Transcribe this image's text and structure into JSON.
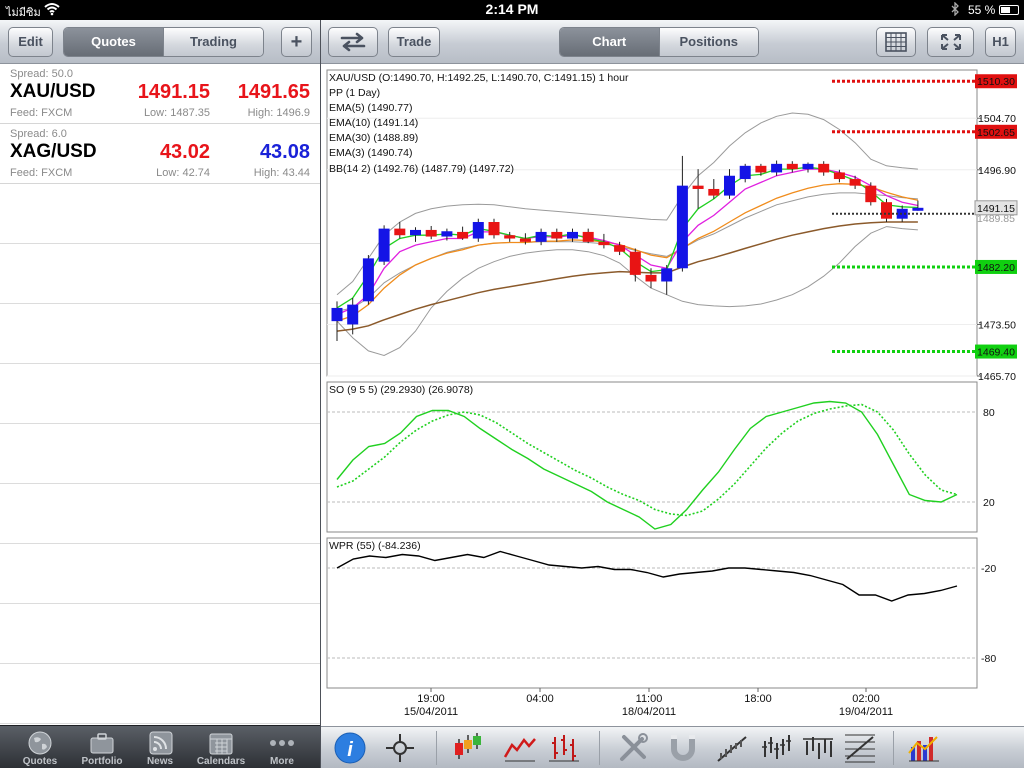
{
  "status_bar": {
    "carrier": "ไม่มีซิม",
    "time": "2:14 PM",
    "battery_text": "55 %",
    "battery_level": 0.55
  },
  "left_toolbar": {
    "edit": "Edit",
    "quotes": "Quotes",
    "trading": "Trading",
    "add": "+"
  },
  "quotes": [
    {
      "spread": "Spread: 50.0",
      "symbol": "XAU/USD",
      "feed": "Feed: FXCM",
      "bid": "1491.15",
      "ask": "1491.65",
      "low": "Low: 1487.35",
      "high": "High: 1496.9",
      "ask_color": "#e8141a"
    },
    {
      "spread": "Spread: 6.0",
      "symbol": "XAG/USD",
      "feed": "Feed: FXCM",
      "bid": "43.02",
      "ask": "43.08",
      "low": "Low: 42.74",
      "high": "High: 43.44",
      "ask_color": "#1a22d8"
    }
  ],
  "tabbar": {
    "items": [
      "Quotes",
      "Portfolio",
      "News",
      "Calendars",
      "More"
    ]
  },
  "right_toolbar": {
    "trade": "Trade",
    "chart": "Chart",
    "positions": "Positions",
    "timeframe": "H1"
  },
  "legend": {
    "main": "XAU/USD (O:1490.70, H:1492.25, L:1490.70, C:1491.15) 1 hour",
    "pp": "PP (1 Day)",
    "ema5": "EMA(5) (1490.77)",
    "ema10": "EMA(10) (1491.14)",
    "ema30": "EMA(30) (1488.89)",
    "ema3": "EMA(3) (1490.74)",
    "bb": "BB(14 2) (1492.76) (1487.79) (1497.72)",
    "so": "SO (9 5 5) (29.2930) (26.9078)",
    "wpr": "WPR (55) (-84.236)"
  },
  "price_axis": {
    "ticks": [
      "1504.70",
      "1496.90",
      "1473.50",
      "1465.70"
    ],
    "current": "1491.15",
    "current_hidden": "1489.85"
  },
  "pivot_levels": [
    {
      "label": "1510.30",
      "value": 1510.3,
      "kind": "resistance"
    },
    {
      "label": "1502.65",
      "value": 1502.65,
      "kind": "resistance"
    },
    {
      "label": "1482.20",
      "value": 1482.2,
      "kind": "support"
    },
    {
      "label": "1469.40",
      "value": 1469.4,
      "kind": "support"
    }
  ],
  "so_axis": {
    "ticks": [
      "80",
      "20"
    ]
  },
  "wpr_axis": {
    "ticks": [
      "-20",
      "-80"
    ]
  },
  "time_axis": [
    {
      "time": "19:00",
      "date": "15/04/2011"
    },
    {
      "time": "04:00",
      "date": ""
    },
    {
      "time": "11:00",
      "date": "18/04/2011"
    },
    {
      "time": "18:00",
      "date": ""
    },
    {
      "time": "02:00",
      "date": "19/04/2011"
    }
  ],
  "colors": {
    "up": "#1414e6",
    "down": "#e81414",
    "resistance": "#e01010",
    "support": "#10d010",
    "ema5": "#e020e0",
    "ema10": "#f08c1c",
    "ema30": "#8b5a2b",
    "ema3": "#20d020",
    "bb": "#9a9a9a"
  },
  "chart_data": {
    "type": "candlestick",
    "symbol": "XAU/USD",
    "interval": "1 hour",
    "ylim": [
      1465.7,
      1512
    ],
    "candles": [
      {
        "o": 1474.0,
        "h": 1477.0,
        "l": 1471.0,
        "c": 1476.0
      },
      {
        "o": 1473.5,
        "h": 1477.5,
        "l": 1472.0,
        "c": 1476.5
      },
      {
        "o": 1477.0,
        "h": 1484.0,
        "l": 1476.5,
        "c": 1483.5
      },
      {
        "o": 1483.0,
        "h": 1488.5,
        "l": 1482.5,
        "c": 1488.0
      },
      {
        "o": 1488.0,
        "h": 1489.0,
        "l": 1486.5,
        "c": 1487.0
      },
      {
        "o": 1487.0,
        "h": 1488.2,
        "l": 1486.0,
        "c": 1487.8
      },
      {
        "o": 1487.8,
        "h": 1488.4,
        "l": 1486.4,
        "c": 1486.8
      },
      {
        "o": 1486.8,
        "h": 1488.0,
        "l": 1486.2,
        "c": 1487.6
      },
      {
        "o": 1487.5,
        "h": 1488.3,
        "l": 1486.3,
        "c": 1486.5
      },
      {
        "o": 1486.5,
        "h": 1489.5,
        "l": 1486.0,
        "c": 1489.0
      },
      {
        "o": 1489.0,
        "h": 1489.5,
        "l": 1486.5,
        "c": 1487.0
      },
      {
        "o": 1487.0,
        "h": 1487.5,
        "l": 1486.0,
        "c": 1486.5
      },
      {
        "o": 1486.5,
        "h": 1487.3,
        "l": 1485.6,
        "c": 1486.0
      },
      {
        "o": 1486.0,
        "h": 1488.0,
        "l": 1485.5,
        "c": 1487.5
      },
      {
        "o": 1487.5,
        "h": 1488.0,
        "l": 1486.0,
        "c": 1486.5
      },
      {
        "o": 1486.5,
        "h": 1488.0,
        "l": 1486.0,
        "c": 1487.5
      },
      {
        "o": 1487.5,
        "h": 1488.0,
        "l": 1485.8,
        "c": 1486.0
      },
      {
        "o": 1486.0,
        "h": 1487.2,
        "l": 1485.0,
        "c": 1485.5
      },
      {
        "o": 1485.5,
        "h": 1486.0,
        "l": 1484.0,
        "c": 1484.5
      },
      {
        "o": 1484.5,
        "h": 1485.0,
        "l": 1480.0,
        "c": 1481.0
      },
      {
        "o": 1481.0,
        "h": 1482.0,
        "l": 1479.0,
        "c": 1480.0
      },
      {
        "o": 1480.0,
        "h": 1482.5,
        "l": 1478.0,
        "c": 1482.0
      },
      {
        "o": 1482.0,
        "h": 1499.0,
        "l": 1481.5,
        "c": 1494.5
      },
      {
        "o": 1494.5,
        "h": 1497.0,
        "l": 1491.0,
        "c": 1494.0
      },
      {
        "o": 1494.0,
        "h": 1495.5,
        "l": 1492.5,
        "c": 1493.0
      },
      {
        "o": 1493.0,
        "h": 1497.0,
        "l": 1492.5,
        "c": 1496.0
      },
      {
        "o": 1495.5,
        "h": 1497.8,
        "l": 1495.0,
        "c": 1497.5
      },
      {
        "o": 1497.5,
        "h": 1497.8,
        "l": 1496.0,
        "c": 1496.5
      },
      {
        "o": 1496.5,
        "h": 1498.3,
        "l": 1496.0,
        "c": 1497.8
      },
      {
        "o": 1497.8,
        "h": 1498.2,
        "l": 1496.5,
        "c": 1497.0
      },
      {
        "o": 1497.0,
        "h": 1498.0,
        "l": 1496.5,
        "c": 1497.8
      },
      {
        "o": 1497.8,
        "h": 1498.2,
        "l": 1496.0,
        "c": 1496.5
      },
      {
        "o": 1496.5,
        "h": 1496.9,
        "l": 1495.0,
        "c": 1495.5
      },
      {
        "o": 1495.5,
        "h": 1496.0,
        "l": 1494.0,
        "c": 1494.5
      },
      {
        "o": 1494.5,
        "h": 1495.0,
        "l": 1491.5,
        "c": 1492.0
      },
      {
        "o": 1492.0,
        "h": 1492.5,
        "l": 1489.0,
        "c": 1489.5
      },
      {
        "o": 1489.5,
        "h": 1491.5,
        "l": 1489.0,
        "c": 1491.0
      },
      {
        "o": 1490.7,
        "h": 1492.25,
        "l": 1490.7,
        "c": 1491.15
      }
    ],
    "ema5": [
      1475.0,
      1476.0,
      1478.0,
      1482.0,
      1484.5,
      1485.5,
      1486.0,
      1486.5,
      1486.5,
      1487.5,
      1487.5,
      1487.0,
      1486.5,
      1486.8,
      1486.7,
      1487.0,
      1486.7,
      1486.2,
      1485.5,
      1484.0,
      1482.5,
      1482.0,
      1486.0,
      1488.5,
      1490.0,
      1492.0,
      1494.0,
      1495.0,
      1496.0,
      1496.5,
      1497.0,
      1497.0,
      1496.5,
      1495.8,
      1494.5,
      1493.0,
      1492.0,
      1491.5
    ],
    "ema10": [
      1474.0,
      1474.8,
      1476.5,
      1479.0,
      1481.0,
      1482.5,
      1483.5,
      1484.3,
      1484.8,
      1485.5,
      1485.8,
      1485.9,
      1485.9,
      1486.1,
      1486.1,
      1486.3,
      1486.2,
      1486.0,
      1485.6,
      1484.8,
      1484.0,
      1483.6,
      1485.0,
      1486.5,
      1487.6,
      1489.0,
      1490.4,
      1491.5,
      1492.6,
      1493.4,
      1494.1,
      1494.6,
      1494.8,
      1494.7,
      1494.3,
      1493.5,
      1492.8,
      1492.3
    ],
    "ema30": [
      1472.5,
      1472.8,
      1473.3,
      1474.2,
      1475.0,
      1475.8,
      1476.5,
      1477.1,
      1477.7,
      1478.3,
      1478.8,
      1479.2,
      1479.6,
      1480.0,
      1480.4,
      1480.8,
      1481.1,
      1481.3,
      1481.5,
      1481.4,
      1481.3,
      1481.3,
      1482.2,
      1483.0,
      1483.6,
      1484.3,
      1485.0,
      1485.7,
      1486.4,
      1487.0,
      1487.5,
      1488.0,
      1488.4,
      1488.7,
      1488.9,
      1489.0,
      1489.0,
      1489.0
    ],
    "ema3": [
      1476.0,
      1477.5,
      1481.0,
      1485.0,
      1486.5,
      1487.0,
      1487.0,
      1487.2,
      1487.0,
      1488.0,
      1487.6,
      1487.0,
      1486.5,
      1487.0,
      1486.8,
      1487.2,
      1486.5,
      1486.0,
      1485.0,
      1483.0,
      1481.5,
      1481.8,
      1488.0,
      1491.0,
      1492.5,
      1494.5,
      1496.0,
      1496.2,
      1497.0,
      1497.0,
      1497.3,
      1497.0,
      1496.2,
      1495.3,
      1493.6,
      1491.6,
      1491.3,
      1491.2
    ],
    "bb_upper": [
      1478.0,
      1480.0,
      1483.5,
      1487.0,
      1489.0,
      1490.3,
      1491.0,
      1491.4,
      1491.6,
      1491.7,
      1491.6,
      1491.3,
      1491.0,
      1490.8,
      1490.6,
      1490.4,
      1490.2,
      1490.0,
      1489.8,
      1489.6,
      1489.4,
      1489.3,
      1493.0,
      1496.0,
      1498.0,
      1500.5,
      1502.5,
      1504.0,
      1505.0,
      1505.5,
      1505.3,
      1504.5,
      1503.0,
      1501.0,
      1498.5,
      1497.5,
      1497.2,
      1497.0
    ],
    "bb_lower": [
      1474.0,
      1471.5,
      1469.5,
      1468.8,
      1470.0,
      1472.5,
      1476.0,
      1478.5,
      1480.5,
      1482.0,
      1483.0,
      1483.8,
      1484.3,
      1484.6,
      1484.8,
      1484.8,
      1484.5,
      1483.9,
      1482.8,
      1480.8,
      1479.0,
      1478.0,
      1477.0,
      1476.5,
      1476.3,
      1476.2,
      1476.3,
      1476.6,
      1477.2,
      1478.0,
      1479.2,
      1480.8,
      1482.8,
      1485.3,
      1487.3,
      1488.3,
      1488.0,
      1487.8
    ],
    "bb_mid": [
      1475.5,
      1476.0,
      1477.5,
      1479.8,
      1481.3,
      1482.5,
      1483.5,
      1484.4,
      1485.0,
      1485.5,
      1485.8,
      1485.9,
      1485.9,
      1486.0,
      1486.0,
      1486.0,
      1485.9,
      1485.7,
      1485.3,
      1484.7,
      1484.2,
      1483.8,
      1485.0,
      1486.3,
      1487.2,
      1488.4,
      1489.6,
      1490.6,
      1491.6,
      1492.2,
      1492.8,
      1493.2,
      1493.4,
      1493.4,
      1493.2,
      1493.0,
      1492.7,
      1492.5
    ],
    "so_k": [
      35,
      48,
      57,
      59,
      66,
      77,
      81,
      81,
      77,
      69,
      62,
      55,
      49,
      42,
      37,
      32,
      27,
      20,
      15,
      10,
      2,
      5,
      15,
      28,
      40,
      55,
      69,
      77,
      80,
      83,
      86,
      87,
      86,
      80,
      65,
      45,
      25,
      21,
      20,
      25
    ],
    "so_d": [
      30,
      34,
      42,
      50,
      60,
      68,
      74,
      78,
      80,
      78,
      73,
      66,
      59,
      53,
      47,
      41,
      36,
      30,
      25,
      21,
      15,
      12,
      11,
      14,
      22,
      32,
      44,
      56,
      66,
      74,
      79,
      82,
      84,
      85,
      80,
      68,
      52,
      38,
      28,
      25
    ],
    "so_ylim": [
      0,
      100
    ],
    "wpr": [
      -20,
      -14,
      -12,
      -13,
      -11,
      -12,
      -15,
      -13,
      -11,
      -13,
      -9,
      -12,
      -15,
      -18,
      -19,
      -20,
      -19,
      -21,
      -21,
      -23,
      -26,
      -24,
      -23,
      -22,
      -20,
      -20,
      -21,
      -22,
      -23,
      -25,
      -28,
      -31,
      -38,
      -38,
      -42,
      -38,
      -37,
      -35,
      -32
    ],
    "wpr_ylim": [
      -100,
      0
    ]
  }
}
